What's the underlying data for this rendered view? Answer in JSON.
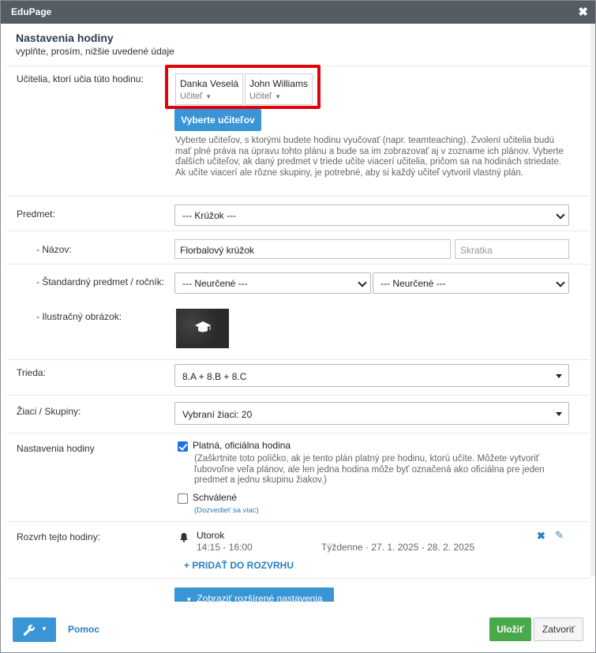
{
  "window": {
    "title": "EduPage"
  },
  "header": {
    "title": "Nastavenia hodiny",
    "subtitle": "vyplňte, prosím, nižšie uvedené údaje"
  },
  "teachers": {
    "label": "Učitelia, ktorí učia túto hodinu:",
    "items": [
      {
        "name": "Danka Veselá",
        "role": "Učiteľ"
      },
      {
        "name": "John Williams",
        "role": "Učiteľ"
      }
    ],
    "select_button": "Vyberte učiteľov",
    "help": "Vyberte učiteľov, s ktorými budete hodinu vyučovať (napr. teamteaching). Zvolení učitelia budú mať plné práva na úpravu tohto plánu a bude sa im zobrazovať aj v zozname ich plánov. Vyberte ďalších učiteľov, ak daný predmet v triede učíte viacerí učitelia, pričom sa na hodinách striedate. Ak učíte viacerí ale rôzne skupiny, je potrebné, aby si každý učiteľ vytvoril vlastný plán."
  },
  "subject": {
    "label": "Predmet:",
    "value": "--- Krúžok ---"
  },
  "name": {
    "label": "- Názov:",
    "value": "Florbalový krúžok",
    "abbrev_placeholder": "Skratka"
  },
  "standard": {
    "label": "- Štandardný predmet / ročník:",
    "subject_value": "--- Neurčené ---",
    "grade_value": "--- Neurčené ---"
  },
  "illustration": {
    "label": "- Ilustračný obrázok:",
    "icon": "graduation-cap-icon"
  },
  "class": {
    "label": "Trieda:",
    "value": "8.A + 8.B + 8.C"
  },
  "students": {
    "label": "Žiaci / Skupiny:",
    "value": "Vybraní žiaci: 20"
  },
  "lesson_settings": {
    "label": "Nastavenia hodiny",
    "official": {
      "label": "Platná, oficiálna hodina",
      "checked": true,
      "help": "(Zaškrtnite toto políčko, ak je tento plán platný pre hodinu, ktorú učíte. Môžete vytvoriť ľubovoľne veľa plánov, ale len jedna hodina môže byť označená ako oficiálna pre jeden predmet a jednu skupinu žiakov.)"
    },
    "approved": {
      "label": "Schválené",
      "checked": false,
      "link": "(Dozvedieť sa viac)"
    }
  },
  "schedule": {
    "label": "Rozvrh tejto hodiny:",
    "entries": [
      {
        "day": "Utorok",
        "time": "14:15 - 16:00",
        "recurrence": "Týždenne · 27. 1. 2025 - 28. 2. 2025"
      }
    ],
    "add_label": "+ PRIDAŤ DO ROZVRHU"
  },
  "advanced_button": "Zobraziť rozšírené nastavenia",
  "footer": {
    "help_label": "Pomoc",
    "save_label": "Uložiť",
    "close_label": "Zatvoriť"
  },
  "colors": {
    "accent": "#3a95d7",
    "save": "#4aa84a",
    "highlight": "#e3000b",
    "titlebar": "#555c64"
  }
}
